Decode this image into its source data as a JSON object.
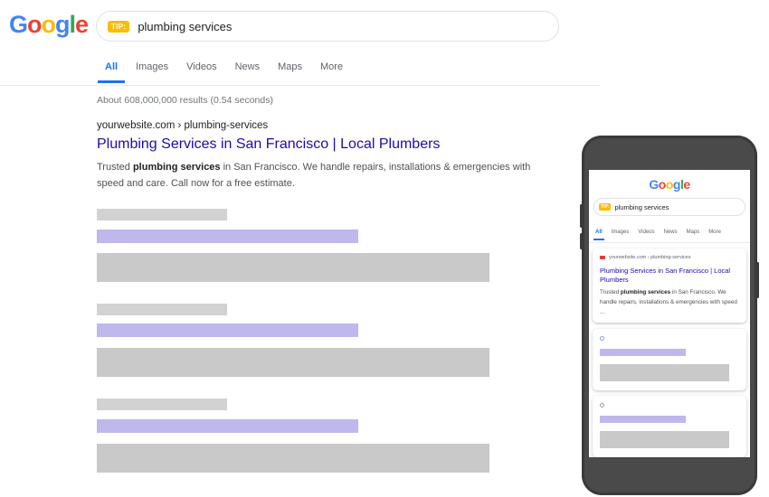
{
  "logo": {
    "text": "Google",
    "letters": [
      {
        "char": "G",
        "color": "#4285F4"
      },
      {
        "char": "o",
        "color": "#EA4335"
      },
      {
        "char": "o",
        "color": "#FBBC05"
      },
      {
        "char": "g",
        "color": "#4285F4"
      },
      {
        "char": "l",
        "color": "#34A853"
      },
      {
        "char": "e",
        "color": "#EA4335"
      }
    ]
  },
  "search": {
    "tip_label": "TIP:",
    "query": "plumbing services"
  },
  "tabs": [
    {
      "label": "All",
      "active": true
    },
    {
      "label": "Images",
      "active": false
    },
    {
      "label": "Videos",
      "active": false
    },
    {
      "label": "News",
      "active": false
    },
    {
      "label": "Maps",
      "active": false
    },
    {
      "label": "More",
      "active": false
    }
  ],
  "result_stats": "About 608,000,000 results (0.54 seconds)",
  "result": {
    "url": "yourwebsite.com › plumbing-services",
    "title": "Plumbing Services in San Francisco | Local Plumbers",
    "snippet_before": "Trusted ",
    "snippet_bold": "plumbing services",
    "snippet_after": " in San Francisco. We handle repairs, installations & emergencies with speed and care. Call now for a free estimate."
  },
  "mobile": {
    "logo_text": "Google",
    "tip_label": "TIP:",
    "query": "plumbing services",
    "tabs": [
      "All",
      "Images",
      "Videos",
      "News",
      "Maps",
      "More"
    ],
    "result": {
      "url": "yourwebsite.com › plumbing-services",
      "title": "Plumbing Services in San Francisco | Local Plumbers",
      "snippet_before": "Trusted ",
      "snippet_bold": "plumbing services",
      "snippet_after": " in San Francisco. We handle repairs, installations & emergencies with speed ..."
    }
  },
  "colors": {
    "accent": "#1a73e8",
    "link": "#1a0dab",
    "tip_badge": "#fbbc04",
    "placeholder_title": "#beb8ec",
    "placeholder_text": "#c9c9c9",
    "phone_body": "#4a4a4a"
  }
}
